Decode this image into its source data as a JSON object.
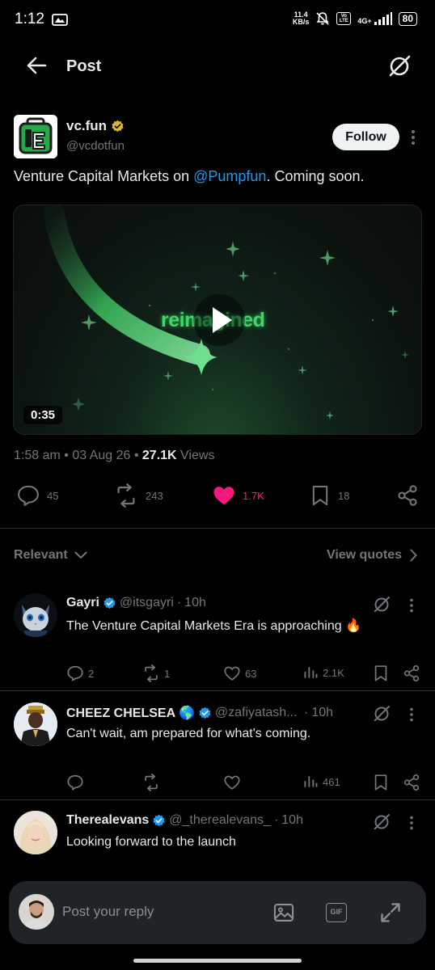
{
  "status_bar": {
    "time": "1:12",
    "net_speed_value": "11.4",
    "net_speed_unit": "KB/s",
    "volte_label": "Vo LTE",
    "network_label": "4G+",
    "battery": "80"
  },
  "header": {
    "title": "Post",
    "back_icon": "arrow-left-icon",
    "grok_icon": "grok-icon"
  },
  "post": {
    "author_name": "vc.fun",
    "author_handle": "@vcdotfun",
    "verified_color": "#e2b719",
    "follow_label": "Follow",
    "text_before": "Venture Capital Markets on ",
    "mention": "@Pumpfun",
    "text_after": ". Coming soon.",
    "media": {
      "word": "reimagined",
      "duration": "0:35"
    },
    "time": "1:58 am",
    "date": "03 Aug 26",
    "views_count": "27.1K",
    "views_label": "Views",
    "actions": {
      "replies": "45",
      "reposts": "243",
      "likes": "1.7K",
      "bookmarks": "18"
    }
  },
  "filter": {
    "sort_label": "Relevant",
    "quotes_label": "View quotes"
  },
  "replies": [
    {
      "name": "Gayri",
      "handle": "@itsgayri",
      "time": "10h",
      "text": "The Venture Capital Markets Era is approaching 🔥",
      "replies": "2",
      "reposts": "1",
      "likes": "63",
      "views": "2.1K"
    },
    {
      "name": "CHEEZ CHELSEA 🌎",
      "handle": "@zafiyatash...",
      "time": "10h",
      "text": "Can't wait, am prepared for what's coming.",
      "replies": "",
      "reposts": "",
      "likes": "",
      "views": "461"
    },
    {
      "name": "Therealevans",
      "handle": "@_therealevans_",
      "time": "10h",
      "text": "Looking forward to the launch"
    }
  ],
  "composer": {
    "placeholder": "Post your reply",
    "gif_label": "GIF"
  },
  "colors": {
    "accent": "#1d9bf0",
    "like": "#f91880",
    "muted": "#71767b",
    "background": "#000000"
  }
}
